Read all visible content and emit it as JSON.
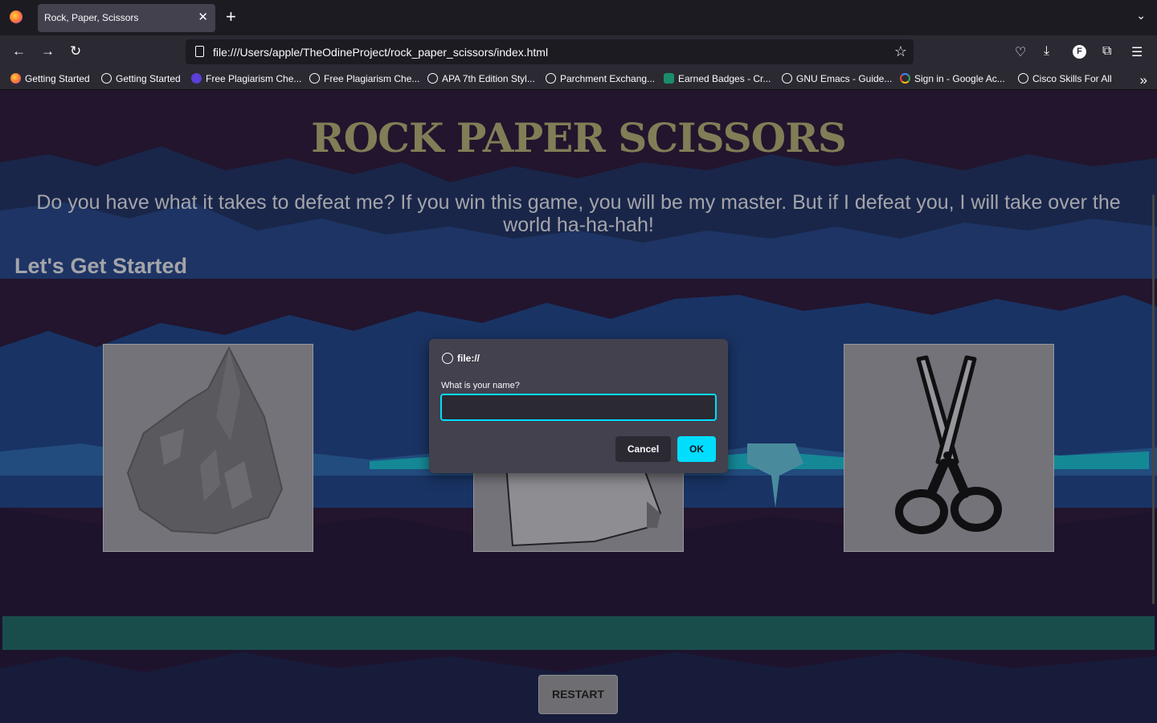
{
  "browser": {
    "tab_title": "Rock, Paper, Scissors",
    "tab_close": "✕",
    "new_tab": "+",
    "url": "file:///Users/apple/TheOdineProject/rock_paper_scissors/index.html",
    "bookmarks": [
      {
        "label": "Getting Started",
        "icon": "firefox-icon"
      },
      {
        "label": "Getting Started",
        "icon": "globe-icon"
      },
      {
        "label": "Free Plagiarism Che...",
        "icon": "plagiarism-icon"
      },
      {
        "label": "Free Plagiarism Che...",
        "icon": "globe-icon"
      },
      {
        "label": "APA 7th Edition Styl...",
        "icon": "globe-icon"
      },
      {
        "label": "Parchment Exchang...",
        "icon": "globe-icon"
      },
      {
        "label": "Earned Badges - Cr...",
        "icon": "credly-icon"
      },
      {
        "label": "GNU Emacs - Guide...",
        "icon": "globe-icon"
      },
      {
        "label": "Sign in - Google Ac...",
        "icon": "google-icon"
      },
      {
        "label": "Cisco Skills For All",
        "icon": "globe-icon"
      }
    ]
  },
  "page": {
    "title": "ROCK PAPER SCISSORS",
    "intro": "Do you have what it takes to defeat me? If you win this game, you will be my master. But if I defeat you, I will take over the world ha-ha-hah!",
    "started": "Let's Get Started",
    "choices": [
      "rock",
      "paper",
      "scissors"
    ],
    "restart_label": "RESTART"
  },
  "dialog": {
    "origin": "file://",
    "label": "What is your name?",
    "input_value": "",
    "cancel_label": "Cancel",
    "ok_label": "OK"
  },
  "colors": {
    "accent": "#00ddff",
    "background": "#2a1a38",
    "title": "#9b9a6a",
    "result_bar": "#1f5f5c"
  }
}
